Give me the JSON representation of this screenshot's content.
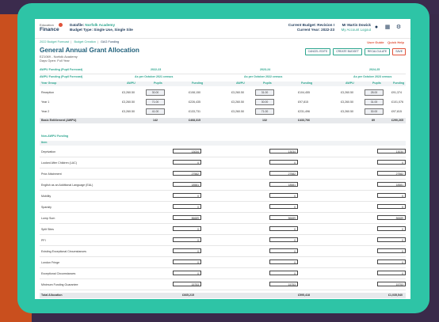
{
  "header": {
    "logo_line1": "Education",
    "logo_line2": "Finance",
    "school_label": "Datafile:",
    "school_name": "Norfolk Academy",
    "budget_type": "Budget Type: Single Use, Single Site",
    "budget_version": "Current Budget: Revision I",
    "current_year": "Current Year: 2022-23",
    "user_name": "Mr Martin Dowick",
    "user_links": "My Account  Logout"
  },
  "breadcrumb": [
    "2022 Budget Forecast",
    "Budget Creation",
    "GAG Funding"
  ],
  "help_links": {
    "user_guide": "User Guide",
    "quick_help": "Quick Help"
  },
  "page": {
    "title": "General Annual Grant Allocation",
    "subtitle": "EZ1069 - Norfolk Academy",
    "schedule": "Days Open: Full Year"
  },
  "actions": [
    "CANCEL EDITS",
    "CREATE BUDGET",
    "RECALCULATE",
    "SAVE"
  ],
  "years": [
    "2022-23",
    "2023-24",
    "2024-25"
  ],
  "pupil_section": {
    "heading": "AWPU Funding (Pupil Forecast)",
    "heading2": "AWPU Funding (Pupil Forecast)",
    "census": "As per October 2021 census",
    "census2": "As per October 2022 census",
    "census3": "As per October 2023 census",
    "col_year_group": "Year Group",
    "col_awpu": "AWPU",
    "col_pupils": "Pupils",
    "col_funding": "Funding",
    "rows": [
      {
        "label": "Reception",
        "awpu": "£3,260.50",
        "pupils": [
          "30.00",
          "31.00",
          "28.00"
        ],
        "funding": [
          "£108,150",
          "£104,455",
          "£91,374"
        ]
      },
      {
        "label": "Year 1",
        "awpu": "£3,260.50",
        "pupils": [
          "71.00",
          "30.00",
          "31.00"
        ],
        "funding": [
          "£226,435",
          "£97,815",
          "£101,076"
        ]
      },
      {
        "label": "Year 2",
        "awpu": "£3,260.50",
        "pupils": [
          "41.00",
          "71.00",
          "30.00"
        ],
        "funding": [
          "£133,731",
          "£231,496",
          "£97,815"
        ]
      }
    ],
    "total_label": "Basic Entitlement (AWPU)",
    "total_pupils": [
      "142",
      "132",
      "89"
    ],
    "total_funding": [
      "£468,315",
      "£433,766",
      "£290,265"
    ]
  },
  "non_awpu": {
    "heading": "Non-AWPU Funding",
    "col_item": "Item",
    "rows": [
      {
        "label": "Deprivation",
        "values": [
          "13034",
          "13034",
          "13034"
        ]
      },
      {
        "label": "Looked After Children (LAC)",
        "values": [
          "0",
          "0",
          "0"
        ]
      },
      {
        "label": "Prior Attainment",
        "values": [
          "27582",
          "27582",
          "27582"
        ]
      },
      {
        "label": "English as an Additional Language (EAL)",
        "values": [
          "18581",
          "18581",
          "18581"
        ]
      },
      {
        "label": "Mobility",
        "values": [
          "0",
          "0",
          "0"
        ]
      },
      {
        "label": "Sparsity",
        "values": [
          "0",
          "0",
          "0"
        ]
      },
      {
        "label": "Lump Sum",
        "values": [
          "86689",
          "86689",
          "86689"
        ]
      },
      {
        "label": "Split Sites",
        "values": [
          "0",
          "0",
          "0"
        ]
      },
      {
        "label": "PFI",
        "values": [
          "0",
          "0",
          "0"
        ]
      },
      {
        "label": "Existing Exceptional Circumstances",
        "values": [
          "0",
          "0",
          "0"
        ]
      },
      {
        "label": "London Fringe",
        "values": [
          "0",
          "0",
          "0"
        ]
      },
      {
        "label": "Exceptional Circumstances",
        "values": [
          "0",
          "0",
          "0"
        ]
      },
      {
        "label": "Minimum Funding Guarantee",
        "values": [
          "15753",
          "15753",
          "15753"
        ]
      }
    ],
    "total_label": "Total Allocation",
    "totals": [
      "£665,215",
      "£595,418",
      "£1,035,540"
    ]
  }
}
